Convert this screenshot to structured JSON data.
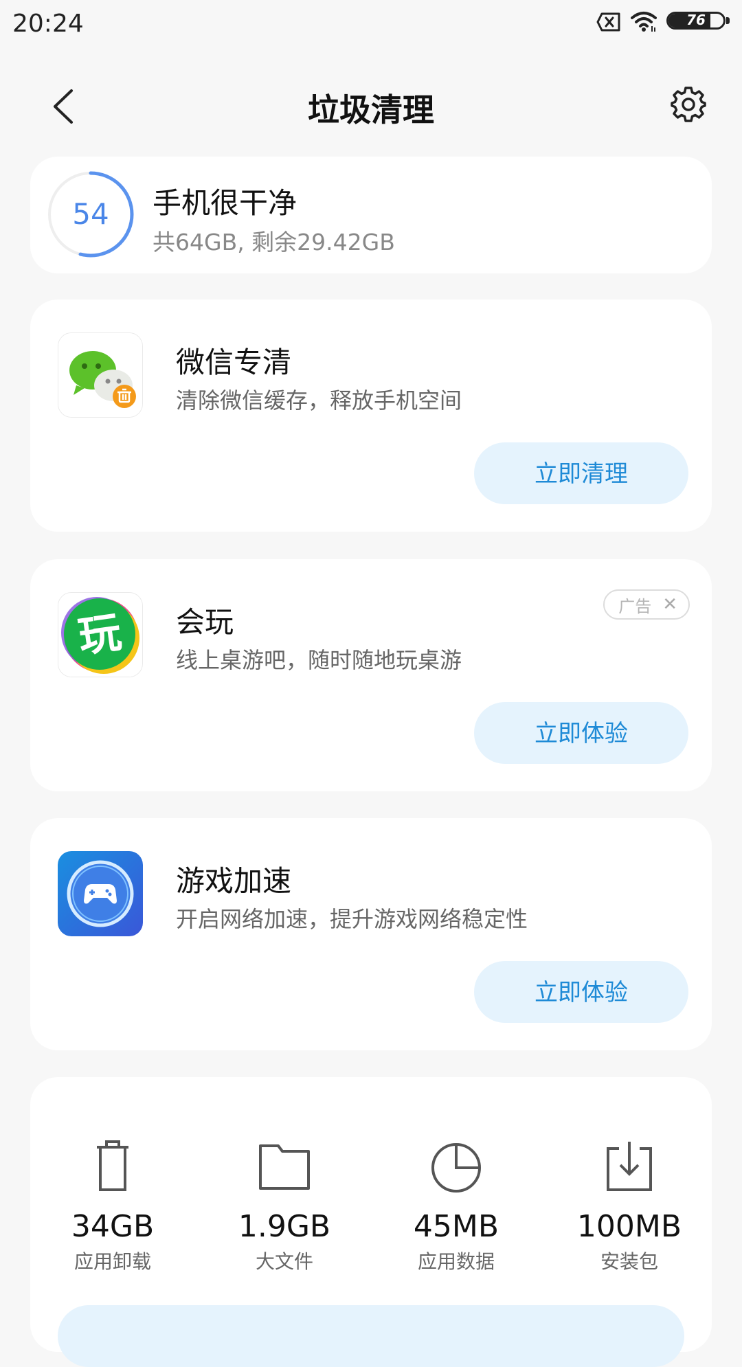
{
  "status_bar": {
    "time": "20:24",
    "battery": 76
  },
  "header": {
    "title": "垃圾清理"
  },
  "storage": {
    "score": "54",
    "score_fraction": 0.54,
    "title": "手机很干净",
    "subtitle": "共64GB, 剩余29.42GB"
  },
  "features": [
    {
      "title": "微信专清",
      "desc": "清除微信缓存，释放手机空间",
      "button": "立即清理"
    },
    {
      "title": "会玩",
      "desc": "线上桌游吧，随时随地玩桌游",
      "button": "立即体验",
      "ad_label": "广告",
      "icon_text": "玩"
    },
    {
      "title": "游戏加速",
      "desc": "开启网络加速，提升游戏网络稳定性",
      "button": "立即体验"
    }
  ],
  "stats": [
    {
      "value": "34GB",
      "label": "应用卸载",
      "icon": "trash-icon"
    },
    {
      "value": "1.9GB",
      "label": "大文件",
      "icon": "folder-icon"
    },
    {
      "value": "45MB",
      "label": "应用数据",
      "icon": "pie-chart-icon"
    },
    {
      "value": "100MB",
      "label": "安装包",
      "icon": "download-box-icon"
    }
  ],
  "colors": {
    "accent": "#1e8ad6",
    "ring": "#5b93ee",
    "button_bg": "#e5f3fd"
  }
}
